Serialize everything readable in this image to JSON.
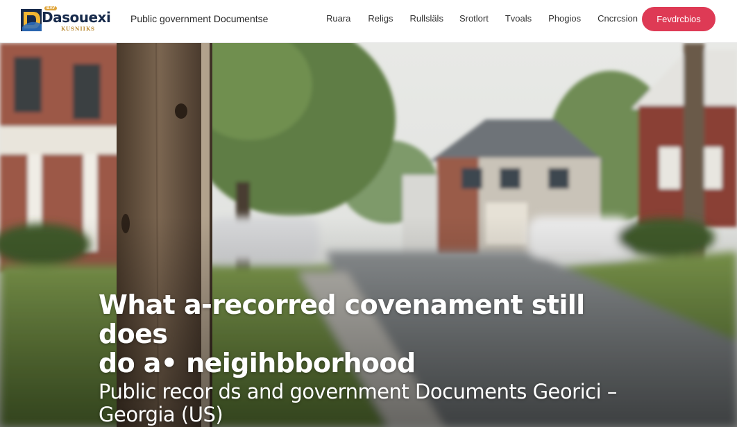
{
  "header": {
    "logo_word": "Dasouexi",
    "logo_sub": "KUSNIIKS",
    "logo_badge": "BAV",
    "tagline": "Public government Documentse",
    "nav": [
      "Ruara",
      "Religs",
      "Rullsläls",
      "Srotlort",
      "Tvoals",
      "Phogios",
      "Cncrcsion"
    ],
    "cta_label": "Fevdrcbios",
    "cta_color": "#de3a55"
  },
  "hero": {
    "headline_line1": "What a-recorred covenament still does",
    "headline_line2": "do a• neigihbborhood",
    "subhead": "Public recor ds  and government Documents Georici – Georgia (US)"
  }
}
